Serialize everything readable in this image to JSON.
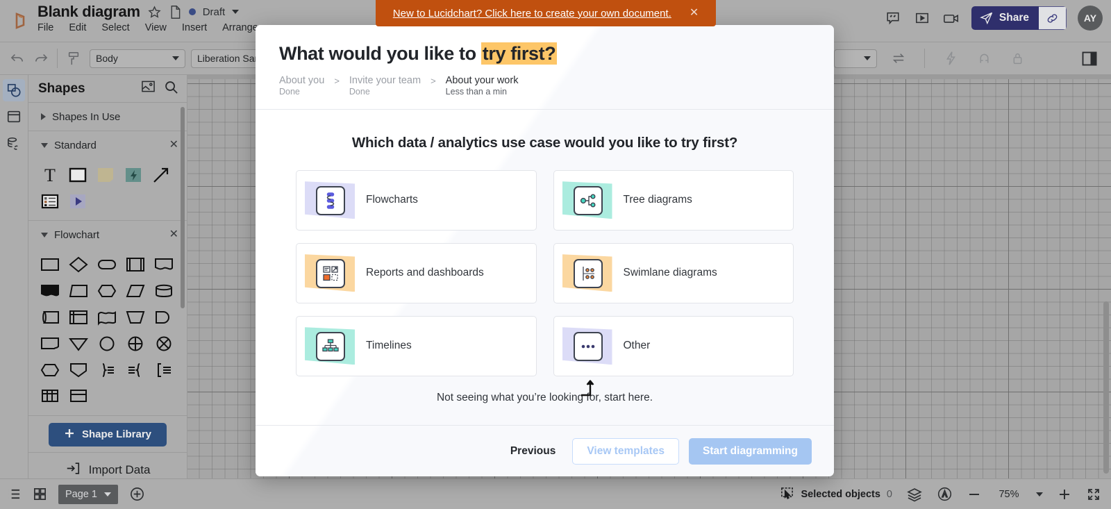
{
  "app": {
    "doc_title": "Blank diagram",
    "status_label": "Draft",
    "menu": [
      "File",
      "Edit",
      "Select",
      "View",
      "Insert",
      "Arrange"
    ],
    "share_label": "Share",
    "avatar_initials": "AY",
    "icons": {
      "logo": "lucid-logo-icon",
      "star": "star-icon",
      "page": "page-icon",
      "comment": "comment-icon",
      "present": "present-icon",
      "video": "video-icon",
      "link": "link-icon"
    }
  },
  "toolbar": {
    "undo": "undo-icon",
    "redo": "redo-icon",
    "format_painter": "format-painter-icon",
    "style_select": "Body",
    "font_select": "Liberation Sans",
    "swap_icon": "swap-icon",
    "lightning_icon": "lightning-icon",
    "magnet_icon": "magnet-icon",
    "lock_icon": "lock-icon",
    "panel_toggle_icon": "right-panel-icon"
  },
  "rail": {
    "items": [
      {
        "name": "shapes-tool",
        "icon": "shapes-icon",
        "active": true
      },
      {
        "name": "templates-tool",
        "icon": "template-icon",
        "active": false
      },
      {
        "name": "data-tool",
        "icon": "data-link-icon",
        "active": false
      }
    ]
  },
  "shapes_panel": {
    "title": "Shapes",
    "header_icons": [
      "image-icon",
      "search-icon"
    ],
    "sections": [
      {
        "label": "Shapes In Use",
        "expanded": false,
        "closable": false
      },
      {
        "label": "Standard",
        "expanded": true,
        "closable": true
      },
      {
        "label": "Flowchart",
        "expanded": true,
        "closable": true
      }
    ],
    "shape_library_button": "Shape Library",
    "import_data_label": "Import Data"
  },
  "bottom_bar": {
    "outline_icon": "outline-icon",
    "grid_icon": "grid-view-icon",
    "page_label": "Page 1",
    "add_page_icon": "add-page-icon",
    "selected_objects_label": "Selected objects",
    "selected_objects_count": "0",
    "layers_icon": "layers-icon",
    "accessibility_icon": "accessibility-icon",
    "zoom_out_icon": "minus-icon",
    "zoom_level": "75%",
    "zoom_in_icon": "plus-icon",
    "fullscreen_icon": "fullscreen-icon"
  },
  "banner": {
    "text": "New to Lucidchart? Click here to create your own document.",
    "close_icon": "close-icon",
    "color": "#c0500f"
  },
  "modal": {
    "heading_plain": "What would you like to ",
    "heading_highlight": "try first?",
    "highlight_color": "#fdc668",
    "steps": [
      {
        "name": "About you",
        "sub": "Done",
        "current": false
      },
      {
        "name": "Invite your team",
        "sub": "Done",
        "current": false
      },
      {
        "name": "About your work",
        "sub": "Less than a min",
        "current": true
      }
    ],
    "step_separator": ">",
    "question": "Which data / analytics use case would you like to try first?",
    "options": [
      {
        "label": "Flowcharts",
        "icon": "flowchart-icon",
        "bg": "#dcdcf7"
      },
      {
        "label": "Tree diagrams",
        "icon": "tree-diagram-icon",
        "bg": "#abecdf"
      },
      {
        "label": "Reports and dashboards",
        "icon": "report-dashboard-icon",
        "bg": "#fbd7a0"
      },
      {
        "label": "Swimlane diagrams",
        "icon": "swimlane-icon",
        "bg": "#fbd7a0"
      },
      {
        "label": "Timelines",
        "icon": "timeline-icon",
        "bg": "#abecdf"
      },
      {
        "label": "Other",
        "icon": "ellipsis-icon",
        "bg": "#dcdcf7"
      }
    ],
    "start_here_text": "Not seeing what you’re looking for, start here.",
    "footer": {
      "previous": "Previous",
      "view_templates": "View templates",
      "start_diagramming": "Start diagramming"
    }
  }
}
